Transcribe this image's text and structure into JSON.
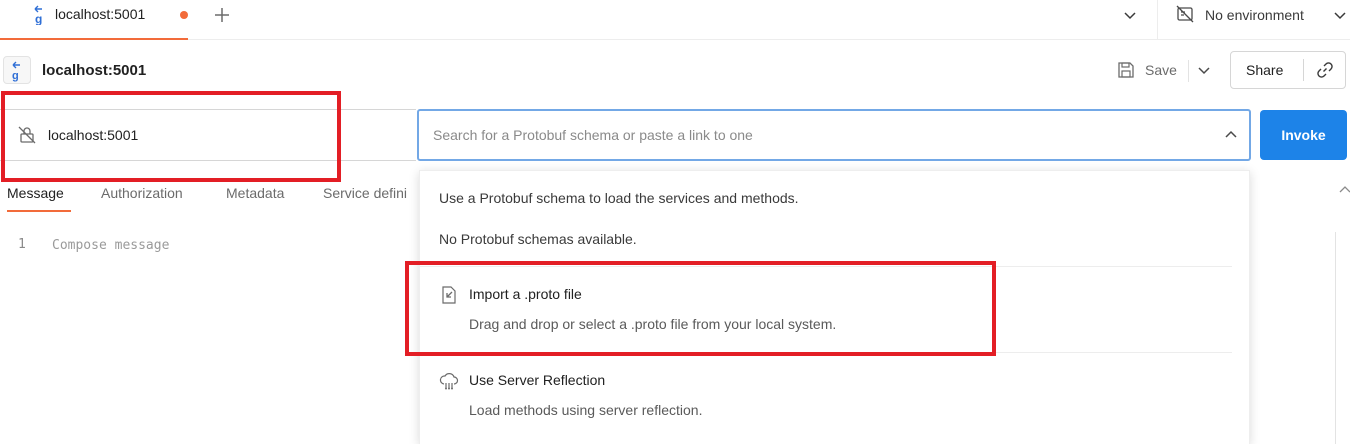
{
  "tabbar": {
    "tab_title": "localhost:5001",
    "new_tab_symbol": "+",
    "environment_label": "No environment"
  },
  "request": {
    "title": "localhost:5001",
    "save_label": "Save",
    "share_label": "Share",
    "invoke_label": "Invoke"
  },
  "url_bar": {
    "server_url": "localhost:5001"
  },
  "search": {
    "placeholder": "Search for a Protobuf schema or paste a link to one"
  },
  "request_tabs": [
    {
      "label": "Message"
    },
    {
      "label": "Authorization"
    },
    {
      "label": "Metadata"
    },
    {
      "label": "Service defini"
    }
  ],
  "editor": {
    "line_number": "1",
    "placeholder": "Compose message"
  },
  "dropdown": {
    "hint": "Use a Protobuf schema to load the services and methods.",
    "empty_state": "No Protobuf schemas available.",
    "options": [
      {
        "title": "Import a .proto file",
        "description": "Drag and drop or select a .proto file from your local system."
      },
      {
        "title": "Use Server Reflection",
        "description": "Load methods using server reflection."
      }
    ]
  },
  "colors": {
    "accent_orange": "#f26b3a",
    "invoke_blue": "#1d83e8",
    "focus_border": "#73a8e6",
    "highlight_red": "#e31e25"
  },
  "icons": [
    "grpc-icon",
    "plus-icon",
    "chevron-down-icon",
    "no-environment-icon",
    "save-icon",
    "link-icon",
    "no-tls-icon",
    "chevron-up-icon",
    "import-file-icon",
    "server-reflection-icon"
  ]
}
